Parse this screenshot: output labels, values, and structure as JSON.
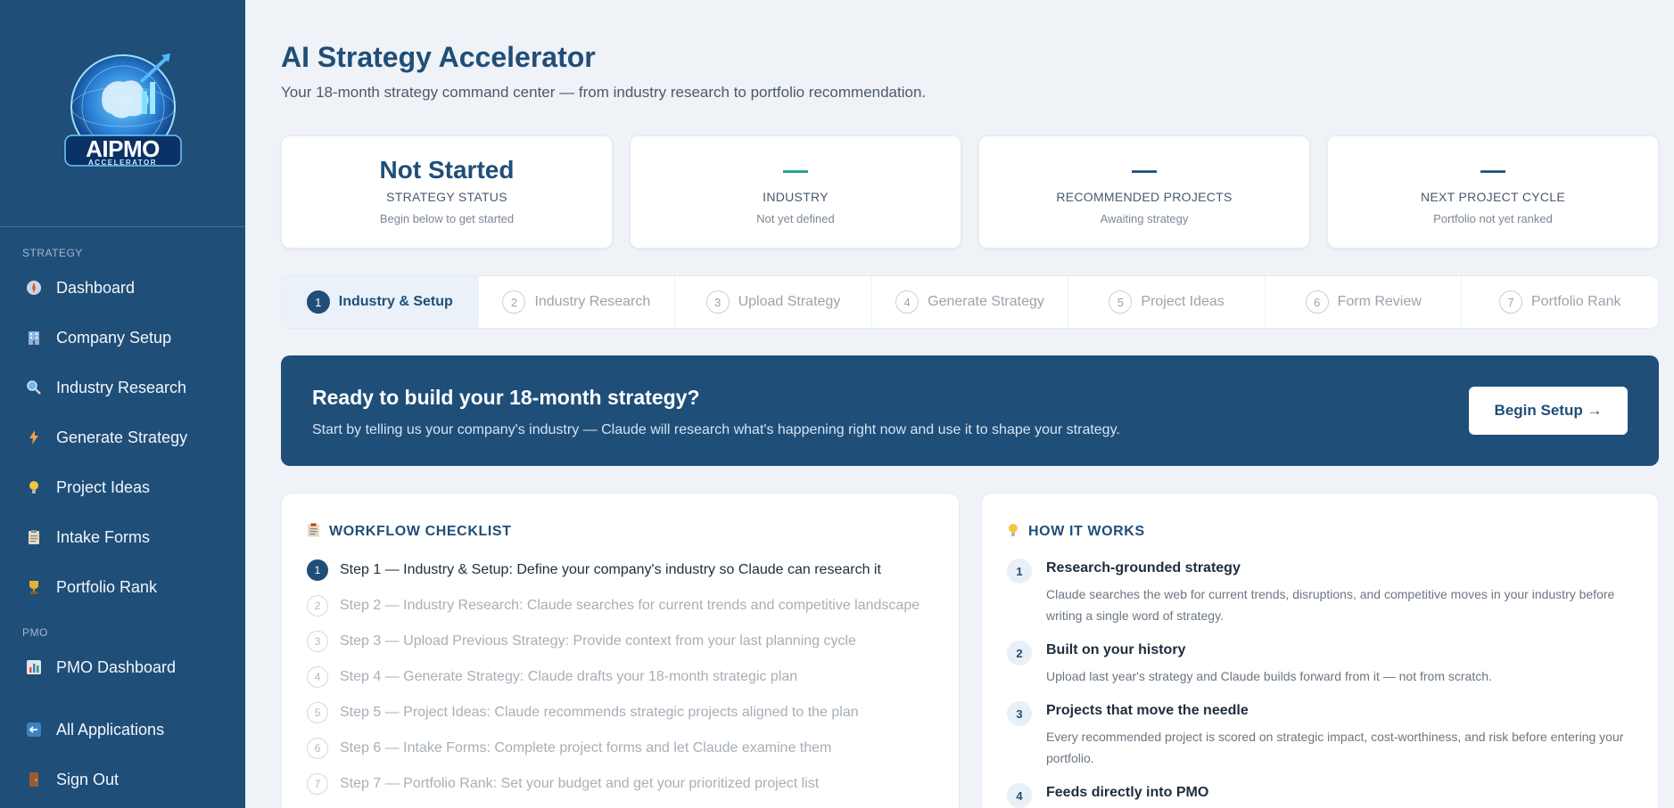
{
  "sidebar": {
    "logo_main": "AIPMO",
    "logo_sub": "ACCELERATOR",
    "strategy_label": "STRATEGY",
    "pmo_label": "PMO",
    "items": [
      {
        "label": "Dashboard",
        "icon": "compass-icon"
      },
      {
        "label": "Company Setup",
        "icon": "building-icon"
      },
      {
        "label": "Industry Research",
        "icon": "magnifier-icon"
      },
      {
        "label": "Generate Strategy",
        "icon": "lightning-icon"
      },
      {
        "label": "Project Ideas",
        "icon": "lightbulb-icon"
      },
      {
        "label": "Intake Forms",
        "icon": "clipboard-icon"
      },
      {
        "label": "Portfolio Rank",
        "icon": "trophy-icon"
      }
    ],
    "pmo_items": [
      {
        "label": "PMO Dashboard",
        "icon": "chart-icon"
      },
      {
        "label": "All Applications",
        "icon": "back-arrow-icon"
      },
      {
        "label": "Sign Out",
        "icon": "door-icon"
      }
    ]
  },
  "header": {
    "title": "AI Strategy Accelerator",
    "subtitle": "Your 18-month strategy command center — from industry research to portfolio recommendation."
  },
  "stats": [
    {
      "value": "Not Started",
      "label": "STRATEGY STATUS",
      "hint": "Begin below to get started"
    },
    {
      "value": "—",
      "label": "INDUSTRY",
      "hint": "Not yet defined"
    },
    {
      "value": "—",
      "label": "RECOMMENDED PROJECTS",
      "hint": "Awaiting strategy"
    },
    {
      "value": "—",
      "label": "NEXT PROJECT CYCLE",
      "hint": "Portfolio not yet ranked"
    }
  ],
  "steps": [
    {
      "num": "1",
      "label": "Industry & Setup"
    },
    {
      "num": "2",
      "label": "Industry Research"
    },
    {
      "num": "3",
      "label": "Upload Strategy"
    },
    {
      "num": "4",
      "label": "Generate Strategy"
    },
    {
      "num": "5",
      "label": "Project Ideas"
    },
    {
      "num": "6",
      "label": "Form Review"
    },
    {
      "num": "7",
      "label": "Portfolio Rank"
    }
  ],
  "banner": {
    "title": "Ready to build your 18-month strategy?",
    "subtitle": "Start by telling us your company's industry — Claude will research what's happening right now and use it to shape your strategy.",
    "button": "Begin Setup →"
  },
  "checklist": {
    "title": "WORKFLOW CHECKLIST",
    "items": [
      {
        "num": "1",
        "text": "Step 1 — Industry & Setup: Define your company's industry so Claude can research it"
      },
      {
        "num": "2",
        "text": "Step 2 — Industry Research: Claude searches for current trends and competitive landscape"
      },
      {
        "num": "3",
        "text": "Step 3 — Upload Previous Strategy: Provide context from your last planning cycle"
      },
      {
        "num": "4",
        "text": "Step 4 — Generate Strategy: Claude drafts your 18-month strategic plan"
      },
      {
        "num": "5",
        "text": "Step 5 — Project Ideas: Claude recommends strategic projects aligned to the plan"
      },
      {
        "num": "6",
        "text": "Step 6 — Intake Forms: Complete project forms and let Claude examine them"
      },
      {
        "num": "7",
        "text": "Step 7 — Portfolio Rank: Set your budget and get your prioritized project list"
      }
    ]
  },
  "how": {
    "title": "HOW IT WORKS",
    "items": [
      {
        "num": "1",
        "title": "Research-grounded strategy",
        "desc": "Claude searches the web for current trends, disruptions, and competitive moves in your industry before writing a single word of strategy."
      },
      {
        "num": "2",
        "title": "Built on your history",
        "desc": "Upload last year's strategy and Claude builds forward from it — not from scratch."
      },
      {
        "num": "3",
        "title": "Projects that move the needle",
        "desc": "Every recommended project is scored on strategic impact, cost-worthiness, and risk before entering your portfolio."
      },
      {
        "num": "4",
        "title": "Feeds directly into PMO",
        "desc": ""
      }
    ]
  }
}
